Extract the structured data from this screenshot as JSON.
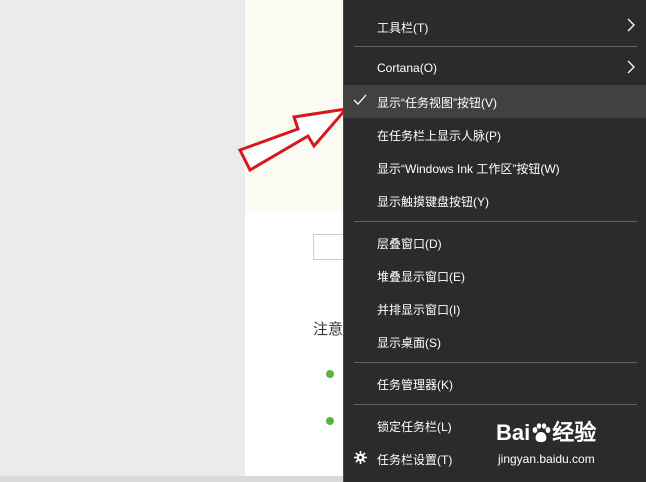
{
  "background": {
    "note_text": "注意"
  },
  "menu": {
    "items": [
      {
        "label": "工具栏(T)",
        "submenu": true
      },
      {
        "label": "Cortana(O)",
        "submenu": true
      },
      {
        "label": "显示“任务视图”按钮(V)",
        "checked": true,
        "selected": true
      },
      {
        "label": "在任务栏上显示人脉(P)"
      },
      {
        "label": "显示“Windows Ink 工作区”按钮(W)"
      },
      {
        "label": "显示触摸键盘按钮(Y)"
      },
      {
        "label": "层叠窗口(D)"
      },
      {
        "label": "堆叠显示窗口(E)"
      },
      {
        "label": "并排显示窗口(I)"
      },
      {
        "label": "显示桌面(S)"
      },
      {
        "label": "任务管理器(K)"
      },
      {
        "label": "锁定任务栏(L)"
      },
      {
        "label": "任务栏设置(T)",
        "icon": "gear-icon"
      }
    ]
  },
  "watermark": {
    "logo_text_left": "Bai",
    "logo_text_right": "经验",
    "url": "jingyan.baidu.com"
  },
  "colors": {
    "menu_bg": "#2b2b2b",
    "menu_selected": "#414141",
    "arrow": "#d9161c",
    "dot": "#5ab33c"
  }
}
